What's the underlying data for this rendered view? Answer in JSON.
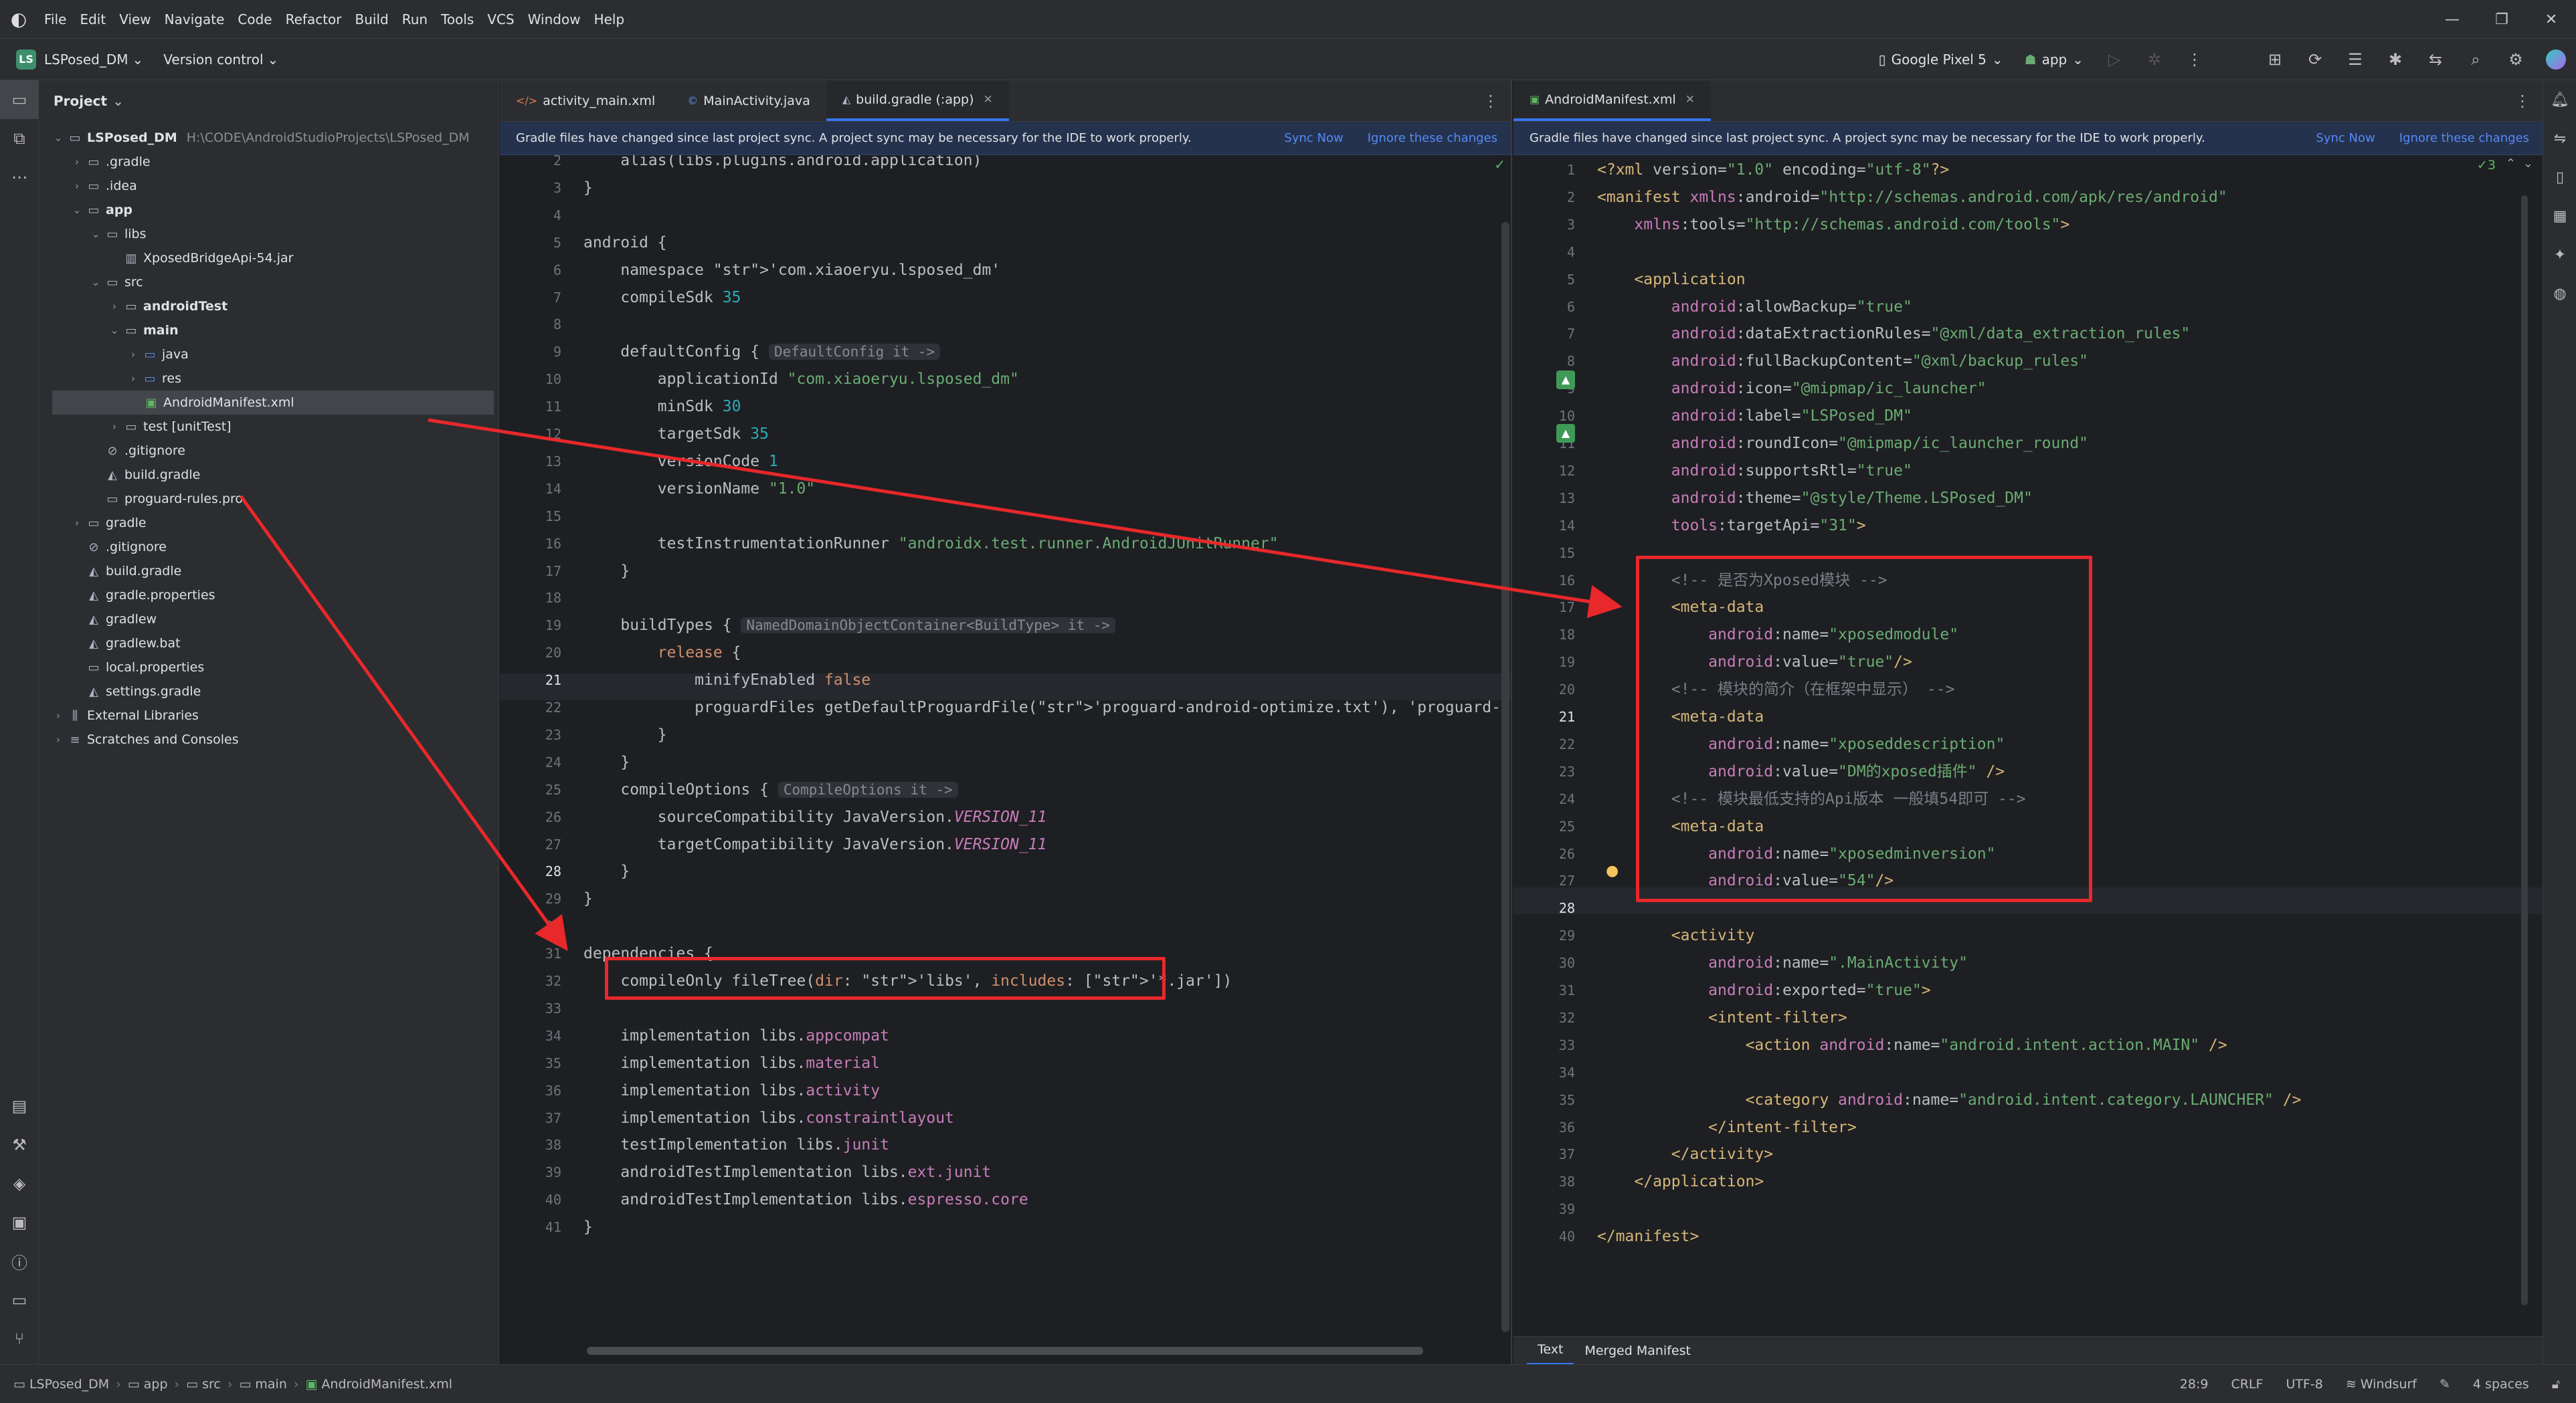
{
  "menu": [
    "File",
    "Edit",
    "View",
    "Navigate",
    "Code",
    "Refactor",
    "Build",
    "Run",
    "Tools",
    "VCS",
    "Window",
    "Help"
  ],
  "toolbar": {
    "project_badge": "LS",
    "project": "LSPosed_DM",
    "vcs": "Version control",
    "device": "Google Pixel 5",
    "run_config": "app"
  },
  "project_panel": {
    "title": "Project",
    "rows": [
      {
        "label": "LSPosed_DM",
        "sub": "H:\\CODE\\AndroidStudioProjects\\LSPosed_DM",
        "depth": 0,
        "open": true,
        "bold": true
      },
      {
        "label": ".gradle",
        "depth": 1,
        "open": false
      },
      {
        "label": ".idea",
        "depth": 1,
        "open": false
      },
      {
        "label": "app",
        "depth": 1,
        "open": true,
        "bold": true
      },
      {
        "label": "libs",
        "depth": 2,
        "open": true
      },
      {
        "label": "XposedBridgeApi-54.jar",
        "depth": 3
      },
      {
        "label": "src",
        "depth": 2,
        "open": true
      },
      {
        "label": "androidTest",
        "depth": 3,
        "open": false,
        "bold": true
      },
      {
        "label": "main",
        "depth": 3,
        "open": true,
        "bold": true
      },
      {
        "label": "java",
        "depth": 4,
        "open": false
      },
      {
        "label": "res",
        "depth": 4,
        "open": false
      },
      {
        "label": "AndroidManifest.xml",
        "depth": 4,
        "selected": true
      },
      {
        "label": "test [unitTest]",
        "depth": 3,
        "open": false
      },
      {
        "label": ".gitignore",
        "depth": 2
      },
      {
        "label": "build.gradle",
        "depth": 2
      },
      {
        "label": "proguard-rules.pro",
        "depth": 2
      },
      {
        "label": "gradle",
        "depth": 1,
        "open": false
      },
      {
        "label": ".gitignore",
        "depth": 1
      },
      {
        "label": "build.gradle",
        "depth": 1
      },
      {
        "label": "gradle.properties",
        "depth": 1
      },
      {
        "label": "gradlew",
        "depth": 1
      },
      {
        "label": "gradlew.bat",
        "depth": 1
      },
      {
        "label": "local.properties",
        "depth": 1
      },
      {
        "label": "settings.gradle",
        "depth": 1
      },
      {
        "label": "External Libraries",
        "depth": 0,
        "open": false
      },
      {
        "label": "Scratches and Consoles",
        "depth": 0,
        "open": false
      }
    ]
  },
  "left_editor": {
    "tabs": [
      "activity_main.xml",
      "MainActivity.java",
      "build.gradle (:app)"
    ],
    "notice": "Gradle files have changed since last project sync. A project sync may be necessary for the IDE to work properly.",
    "sync_now": "Sync Now",
    "ignore": "Ignore these changes"
  },
  "right_editor": {
    "tabs": [
      "AndroidManifest.xml"
    ],
    "notice": "Gradle files have changed since last project sync. A project sync may be necessary for the IDE to work properly.",
    "sync_now": "Sync Now",
    "ignore": "Ignore these changes",
    "bottom_tabs": [
      "Text",
      "Merged Manifest"
    ]
  },
  "gradle_code": [
    {
      "n": 2,
      "t": "    alias(libs.plugins.android.application)"
    },
    {
      "n": 3,
      "t": "}"
    },
    {
      "n": 4,
      "t": ""
    },
    {
      "n": 5,
      "t": "android {"
    },
    {
      "n": 6,
      "t": "    namespace 'com.xiaoeryu.lsposed_dm'"
    },
    {
      "n": 7,
      "t": "    compileSdk 35"
    },
    {
      "n": 8,
      "t": ""
    },
    {
      "n": 9,
      "t": "    defaultConfig {",
      "hint": "DefaultConfig it ->"
    },
    {
      "n": 10,
      "t": "        applicationId \"com.xiaoeryu.lsposed_dm\""
    },
    {
      "n": 11,
      "t": "        minSdk 30"
    },
    {
      "n": 12,
      "t": "        targetSdk 35"
    },
    {
      "n": 13,
      "t": "        versionCode 1"
    },
    {
      "n": 14,
      "t": "        versionName \"1.0\""
    },
    {
      "n": 15,
      "t": ""
    },
    {
      "n": 16,
      "t": "        testInstrumentationRunner \"androidx.test.runner.AndroidJUnitRunner\""
    },
    {
      "n": 17,
      "t": "    }"
    },
    {
      "n": 18,
      "t": ""
    },
    {
      "n": 19,
      "t": "    buildTypes {",
      "hint": "NamedDomainObjectContainer<BuildType> it ->"
    },
    {
      "n": 20,
      "t": "        release {"
    },
    {
      "n": 21,
      "t": "            minifyEnabled false"
    },
    {
      "n": 22,
      "t": "            proguardFiles getDefaultProguardFile('proguard-android-optimize.txt'), 'proguard-rules.p"
    },
    {
      "n": 23,
      "t": "        }"
    },
    {
      "n": 24,
      "t": "    }"
    },
    {
      "n": 25,
      "t": "    compileOptions {",
      "hint": "CompileOptions it ->"
    },
    {
      "n": 26,
      "t": "        sourceCompatibility JavaVersion.VERSION_11"
    },
    {
      "n": 27,
      "t": "        targetCompatibility JavaVersion.VERSION_11"
    },
    {
      "n": 28,
      "t": "    }"
    },
    {
      "n": 29,
      "t": "}"
    },
    {
      "n": 30,
      "t": ""
    },
    {
      "n": 31,
      "t": "dependencies {"
    },
    {
      "n": 32,
      "t": "    compileOnly fileTree(dir: 'libs', includes: ['*.jar'])"
    },
    {
      "n": 33,
      "t": ""
    },
    {
      "n": 34,
      "t": "    implementation libs.appcompat"
    },
    {
      "n": 35,
      "t": "    implementation libs.material"
    },
    {
      "n": 36,
      "t": "    implementation libs.activity"
    },
    {
      "n": 37,
      "t": "    implementation libs.constraintlayout"
    },
    {
      "n": 38,
      "t": "    testImplementation libs.junit"
    },
    {
      "n": 39,
      "t": "    androidTestImplementation libs.ext.junit"
    },
    {
      "n": 40,
      "t": "    androidTestImplementation libs.espresso.core"
    },
    {
      "n": 41,
      "t": "}"
    }
  ],
  "manifest_code": [
    {
      "n": 1,
      "t": "<?xml version=\"1.0\" encoding=\"utf-8\"?>"
    },
    {
      "n": 2,
      "t": "<manifest xmlns:android=\"http://schemas.android.com/apk/res/android\""
    },
    {
      "n": 3,
      "t": "    xmlns:tools=\"http://schemas.android.com/tools\">"
    },
    {
      "n": 4,
      "t": ""
    },
    {
      "n": 5,
      "t": "    <application"
    },
    {
      "n": 6,
      "t": "        android:allowBackup=\"true\""
    },
    {
      "n": 7,
      "t": "        android:dataExtractionRules=\"@xml/data_extraction_rules\""
    },
    {
      "n": 8,
      "t": "        android:fullBackupContent=\"@xml/backup_rules\""
    },
    {
      "n": 9,
      "t": "        android:icon=\"@mipmap/ic_launcher\""
    },
    {
      "n": 10,
      "t": "        android:label=\"LSPosed_DM\""
    },
    {
      "n": 11,
      "t": "        android:roundIcon=\"@mipmap/ic_launcher_round\""
    },
    {
      "n": 12,
      "t": "        android:supportsRtl=\"true\""
    },
    {
      "n": 13,
      "t": "        android:theme=\"@style/Theme.LSPosed_DM\""
    },
    {
      "n": 14,
      "t": "        tools:targetApi=\"31\">"
    },
    {
      "n": 15,
      "t": ""
    },
    {
      "n": 16,
      "t": "        <!-- 是否为Xposed模块 -->"
    },
    {
      "n": 17,
      "t": "        <meta-data"
    },
    {
      "n": 18,
      "t": "            android:name=\"xposedmodule\""
    },
    {
      "n": 19,
      "t": "            android:value=\"true\"/>"
    },
    {
      "n": 20,
      "t": "        <!-- 模块的简介（在框架中显示） -->"
    },
    {
      "n": 21,
      "t": "        <meta-data"
    },
    {
      "n": 22,
      "t": "            android:name=\"xposeddescription\""
    },
    {
      "n": 23,
      "t": "            android:value=\"DM的xposed插件\" />"
    },
    {
      "n": 24,
      "t": "        <!-- 模块最低支持的Api版本 一般填54即可 -->"
    },
    {
      "n": 25,
      "t": "        <meta-data"
    },
    {
      "n": 26,
      "t": "            android:name=\"xposedminversion\""
    },
    {
      "n": 27,
      "t": "            android:value=\"54\"/>"
    },
    {
      "n": 28,
      "t": ""
    },
    {
      "n": 29,
      "t": "        <activity"
    },
    {
      "n": 30,
      "t": "            android:name=\".MainActivity\""
    },
    {
      "n": 31,
      "t": "            android:exported=\"true\">"
    },
    {
      "n": 32,
      "t": "            <intent-filter>"
    },
    {
      "n": 33,
      "t": "                <action android:name=\"android.intent.action.MAIN\" />"
    },
    {
      "n": 34,
      "t": ""
    },
    {
      "n": 35,
      "t": "                <category android:name=\"android.intent.category.LAUNCHER\" />"
    },
    {
      "n": 36,
      "t": "            </intent-filter>"
    },
    {
      "n": 37,
      "t": "        </activity>"
    },
    {
      "n": 38,
      "t": "    </application>"
    },
    {
      "n": 39,
      "t": ""
    },
    {
      "n": 40,
      "t": "</manifest>"
    }
  ],
  "inspection_badge": "✓3",
  "status": {
    "breadcrumb": [
      "LSPosed_DM",
      "app",
      "src",
      "main",
      "AndroidManifest.xml"
    ],
    "position": "28:9",
    "line_sep": "CRLF",
    "encoding": "UTF-8",
    "plugin": "Windsurf",
    "indent": "4 spaces"
  },
  "colors": {
    "annotation_red": "#e8282b",
    "accent": "#3574f0"
  }
}
